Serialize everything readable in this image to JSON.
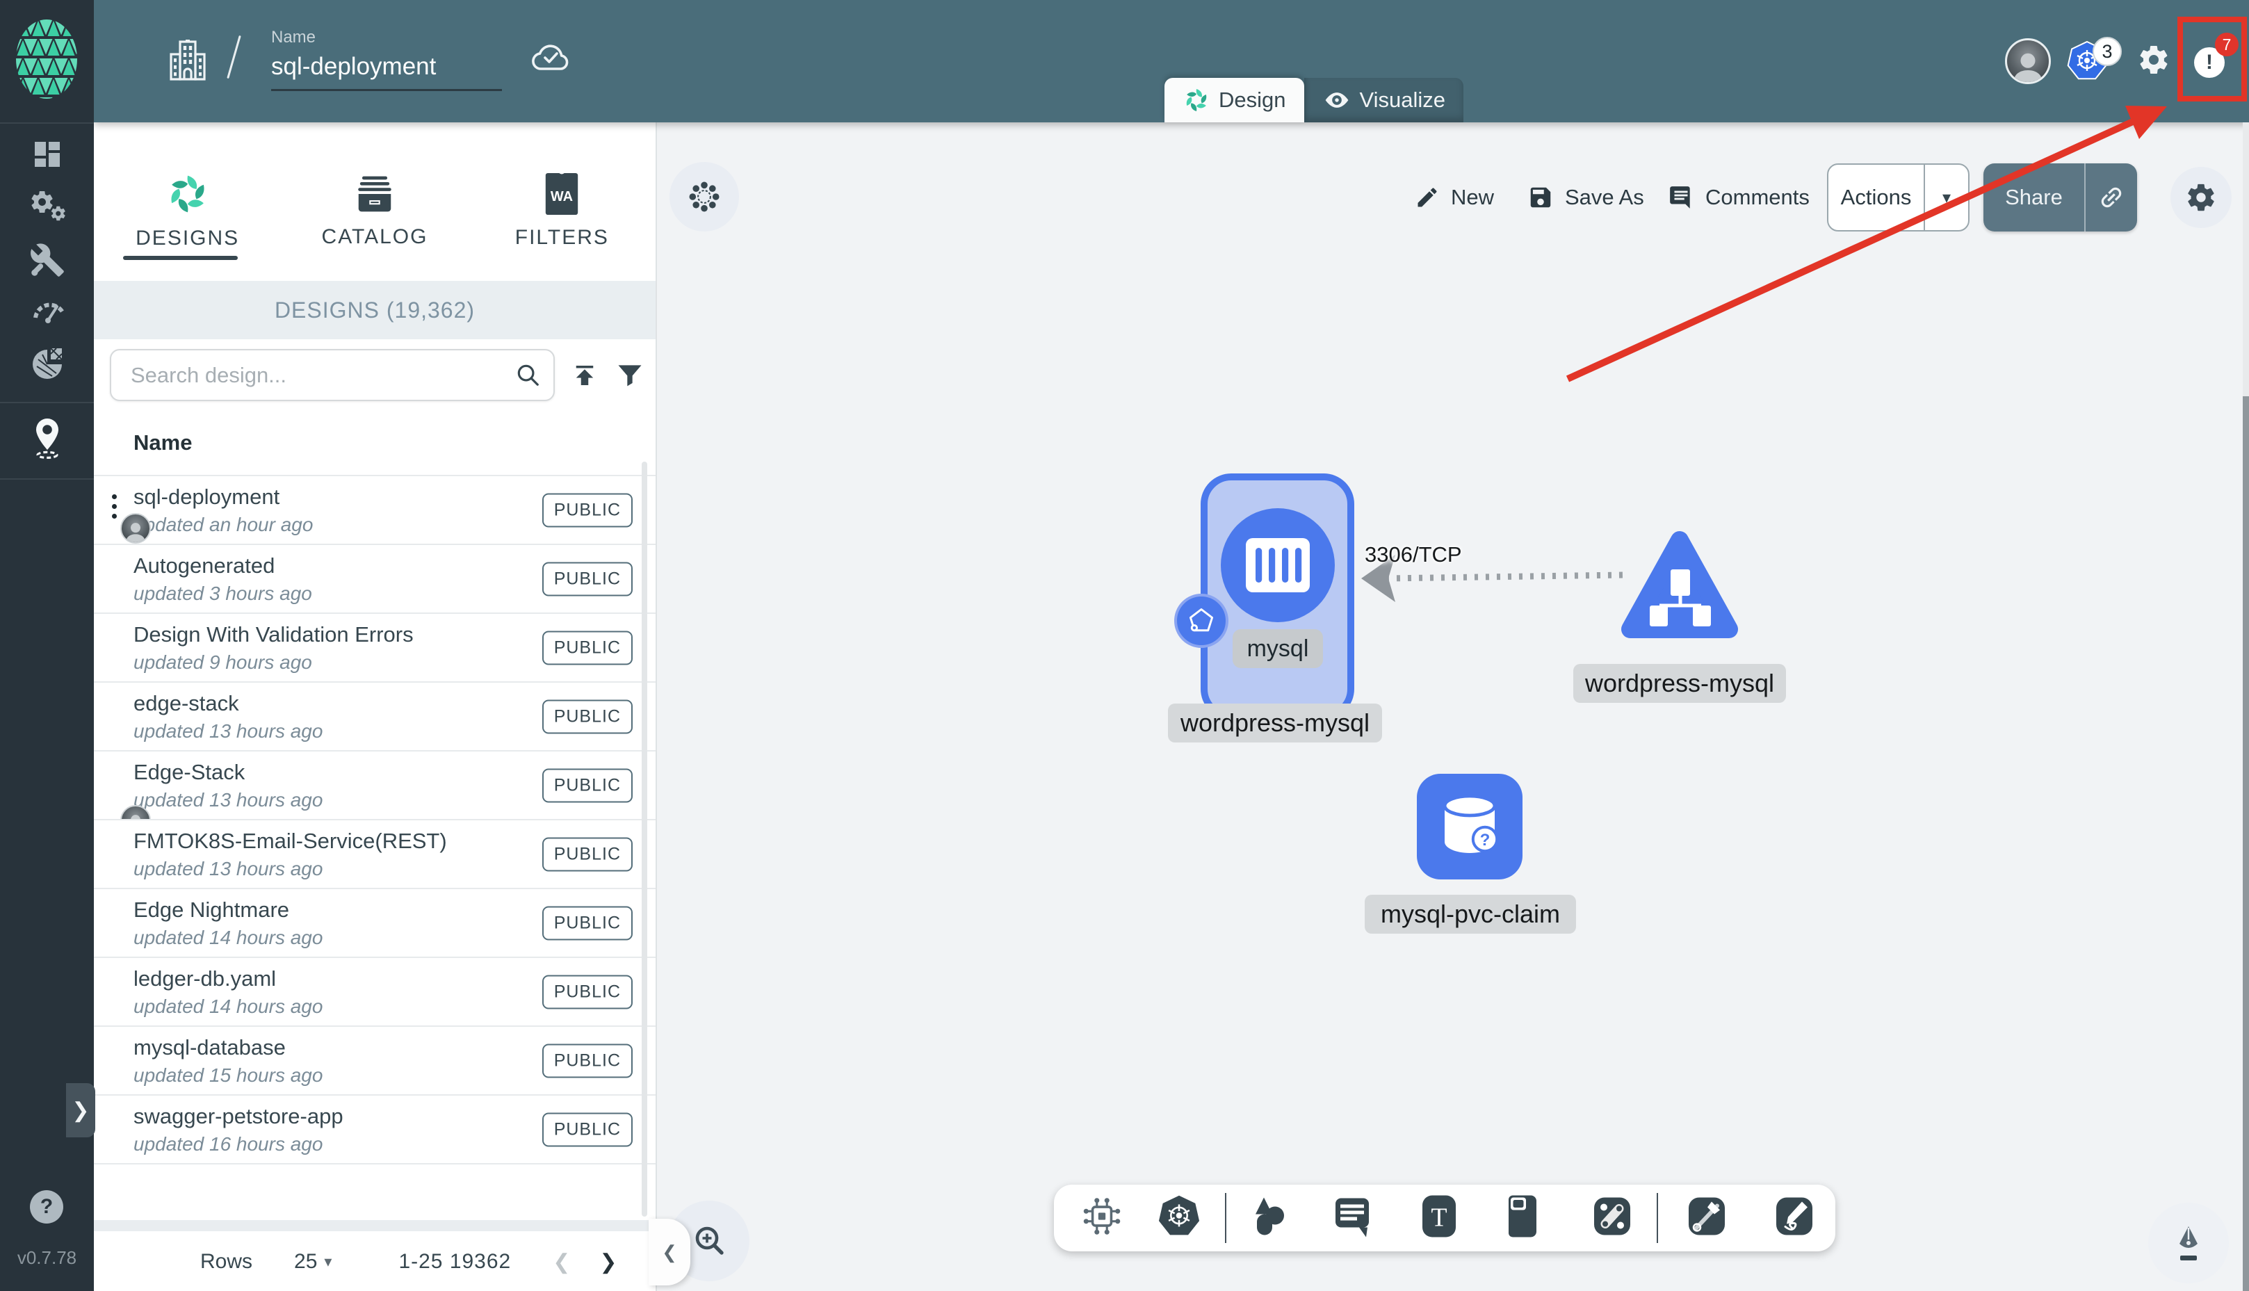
{
  "version": "v0.7.78",
  "header": {
    "name_label": "Name",
    "design_name": "sql-deployment",
    "k8s_context_count": "3",
    "notification_count": "7",
    "mode_tabs": [
      {
        "label": "Design"
      },
      {
        "label": "Visualize"
      }
    ]
  },
  "panel": {
    "tabs": [
      {
        "label": "DESIGNS"
      },
      {
        "label": "CATALOG"
      },
      {
        "label": "FILTERS"
      }
    ],
    "section_title": "DESIGNS (19,362)",
    "search": {
      "placeholder": "Search design..."
    },
    "columns": {
      "name": "Name"
    },
    "designs": [
      {
        "name": "sql-deployment",
        "updated": "updated an hour ago",
        "visibility": "PUBLIC"
      },
      {
        "name": "Autogenerated",
        "updated": "updated 3 hours ago",
        "visibility": "PUBLIC"
      },
      {
        "name": "Design With Validation Errors",
        "updated": "updated 9 hours ago",
        "visibility": "PUBLIC"
      },
      {
        "name": "edge-stack",
        "updated": "updated 13 hours ago",
        "visibility": "PUBLIC"
      },
      {
        "name": "Edge-Stack",
        "updated": "updated 13 hours ago",
        "visibility": "PUBLIC"
      },
      {
        "name": "FMTOK8S-Email-Service(REST)",
        "updated": "updated 13 hours ago",
        "visibility": "PUBLIC"
      },
      {
        "name": "Edge Nightmare",
        "updated": "updated 14 hours ago",
        "visibility": "PUBLIC"
      },
      {
        "name": "ledger-db.yaml",
        "updated": "updated 14 hours ago",
        "visibility": "PUBLIC"
      },
      {
        "name": "mysql-database",
        "updated": "updated 15 hours ago",
        "visibility": "PUBLIC"
      },
      {
        "name": "swagger-petstore-app",
        "updated": "updated 16 hours ago",
        "visibility": "PUBLIC"
      }
    ],
    "pagination": {
      "rows_label": "Rows",
      "page_size": "25",
      "range": "1-25 19362",
      "prev": "❮",
      "next": "❯"
    }
  },
  "toolbar": {
    "new": "New",
    "save_as": "Save As",
    "comments": "Comments",
    "actions": "Actions",
    "actions_caret": "▾",
    "share": "Share"
  },
  "canvas": {
    "edge_label": "3306/TCP",
    "pod": {
      "container_label": "mysql",
      "node_label": "wordpress-mysql"
    },
    "service": {
      "node_label": "wordpress-mysql"
    },
    "pvc": {
      "node_label": "mysql-pvc-claim"
    }
  },
  "icons": {
    "wasm_label": "WA",
    "text_tool_label": "T"
  },
  "misc": {
    "help": "?",
    "expand_right": "❯",
    "collapse_left": "❮"
  },
  "colors": {
    "accent_green": "#00B39F",
    "node_blue": "#4B79EC",
    "highlight_red": "#E0352B",
    "header_teal": "#4A6D7A",
    "rail_dark": "#28333B"
  }
}
